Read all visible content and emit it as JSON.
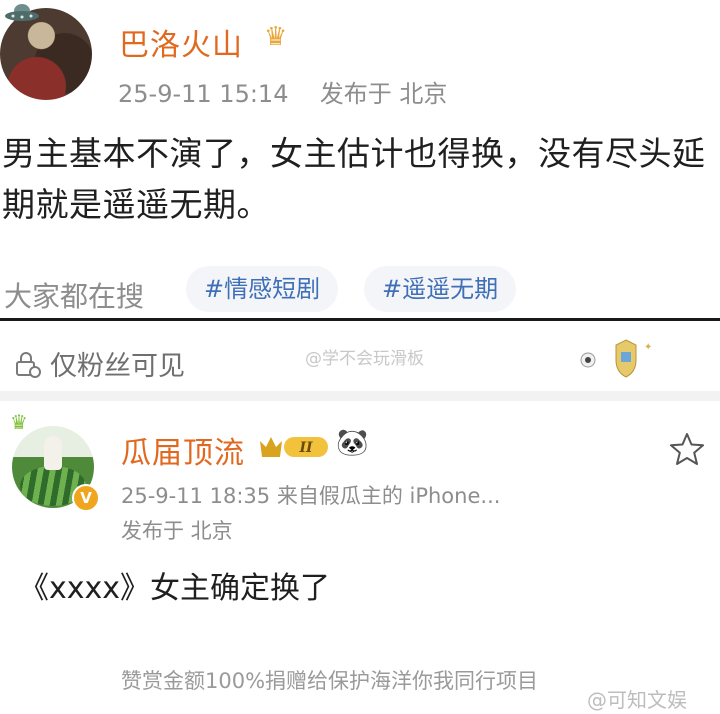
{
  "post1": {
    "username": "巴洛火山",
    "crown_icon": "crown-icon",
    "timestamp": "25-9-11 15:14",
    "location": "发布于 北京",
    "content": "男主基本不演了，女主估计也得换，没有尽头延期就是遥遥无期。",
    "search_label": "大家都在搜",
    "tags": [
      "#情感短剧",
      "#遥遥无期"
    ]
  },
  "post2": {
    "visibility": "仅粉丝可见",
    "watermark": "@学不会玩滑板",
    "username": "瓜届顶流",
    "rank_badge": "II",
    "verified_badge": "V",
    "timestamp_source": "25-9-11 18:35  来自假瓜主的 iPhone...",
    "location": "发布于 北京",
    "content": "《xxxx》女主确定换了",
    "reward_text": "赞赏金额100%捐赠给保护海洋你我同行项目",
    "corner_watermark": "@可知文娱"
  },
  "colors": {
    "username": "#e0691f",
    "meta": "#8d8d8d",
    "tag_text": "#3f6fb6",
    "tag_bg": "#f3f5f8"
  }
}
